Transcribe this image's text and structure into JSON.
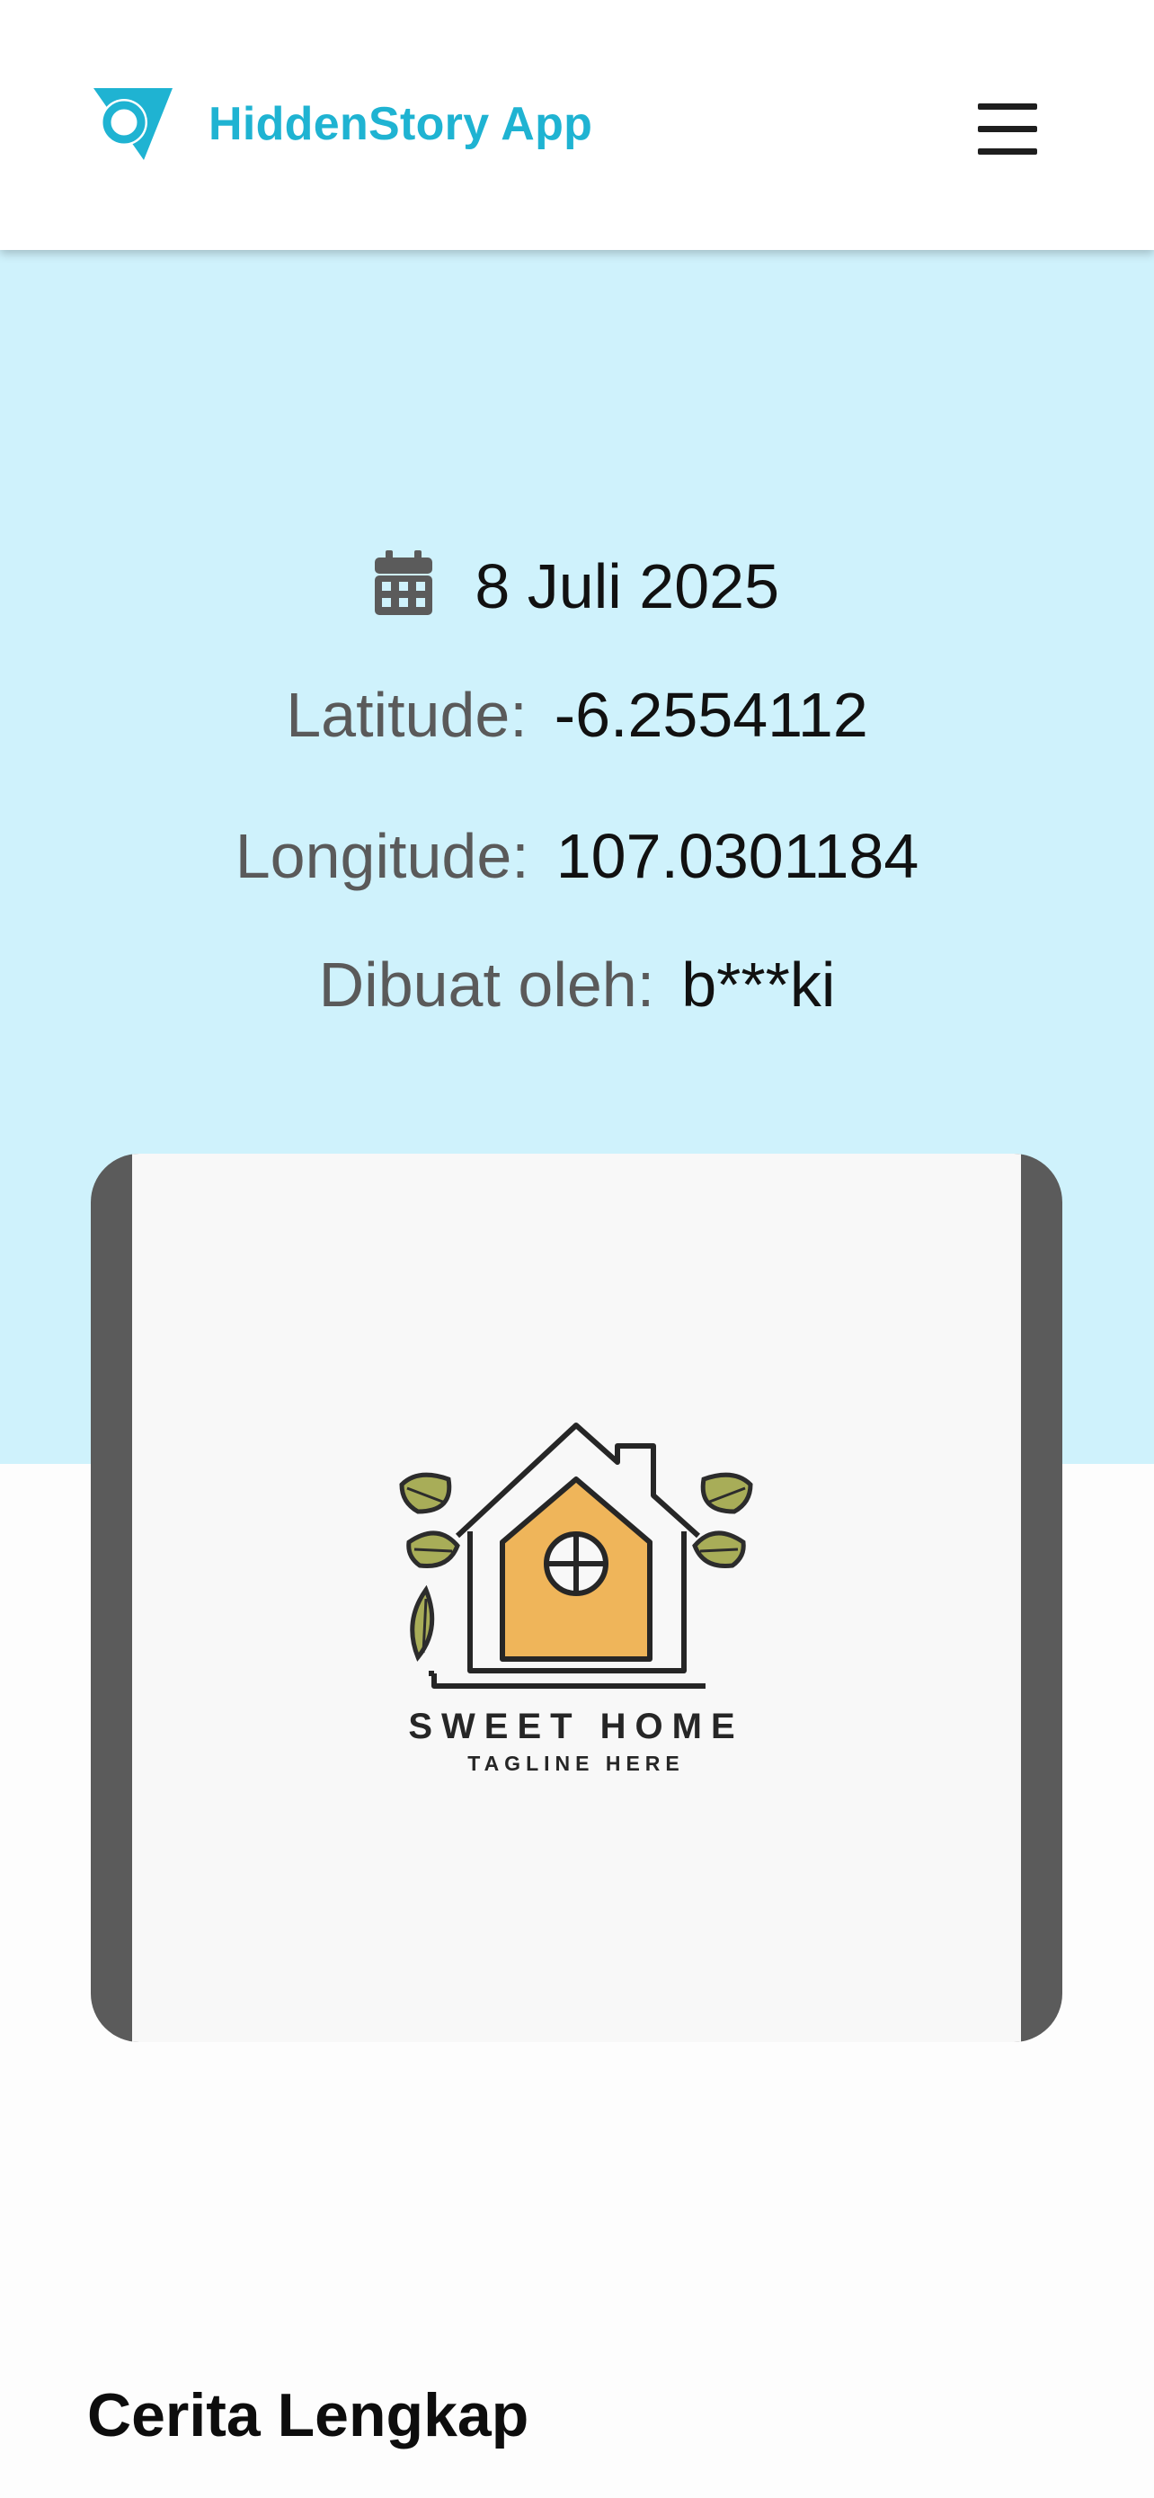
{
  "header": {
    "app_name": "HiddenStory App",
    "logo_icon": "target-logo-icon",
    "menu_icon": "hamburger-menu-icon",
    "brand_color": "#1fb3d2"
  },
  "story": {
    "date_icon": "calendar-icon",
    "date": "8 Juli 2025",
    "latitude_label": "Latitude:",
    "latitude": "-6.2554112",
    "longitude_label": "Longitude:",
    "longitude": "107.0301184",
    "author_label": "Dibuat oleh:",
    "author": "b***ki",
    "hero_color": "#cff2fc"
  },
  "image": {
    "brand_text": "SWEET HOME",
    "tagline": "TAGLINE HERE"
  },
  "section": {
    "title": "Cerita Lengkap"
  }
}
